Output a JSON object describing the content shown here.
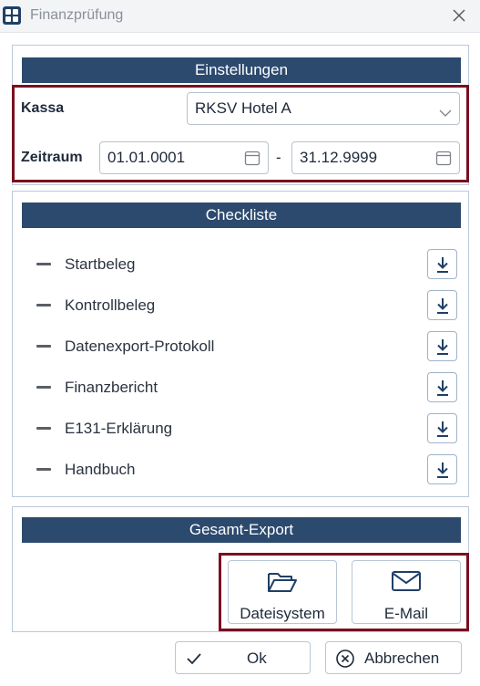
{
  "window": {
    "title": "Finanzprüfung"
  },
  "settings": {
    "header": "Einstellungen",
    "kassa_label": "Kassa",
    "kassa_value": "RKSV Hotel A",
    "zeitraum_label": "Zeitraum",
    "date_from": "01.01.0001",
    "date_separator": "-",
    "date_to": "31.12.9999"
  },
  "checklist": {
    "header": "Checkliste",
    "items": [
      {
        "label": "Startbeleg"
      },
      {
        "label": "Kontrollbeleg"
      },
      {
        "label": "Datenexport-Protokoll"
      },
      {
        "label": "Finanzbericht"
      },
      {
        "label": "E131-Erklärung"
      },
      {
        "label": "Handbuch"
      }
    ]
  },
  "export": {
    "header": "Gesamt-Export",
    "filesystem_label": "Dateisystem",
    "email_label": "E-Mail"
  },
  "footer": {
    "ok_label": "Ok",
    "cancel_label": "Abbrechen"
  },
  "colors": {
    "header_bg": "#2c4a6e",
    "highlight": "#7a1020",
    "panel_border": "#b8c9dc"
  }
}
